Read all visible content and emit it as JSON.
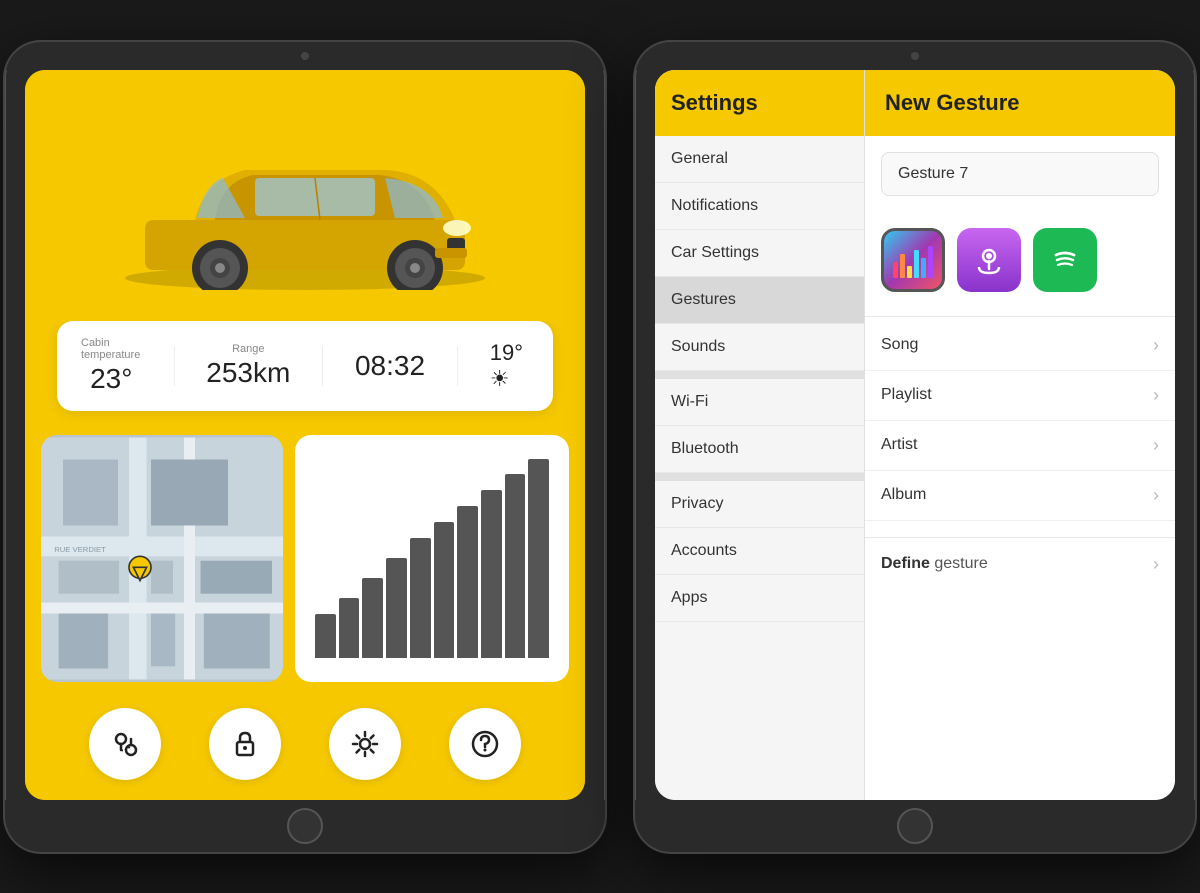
{
  "scene": {
    "background": "#1a1a1a"
  },
  "left_tablet": {
    "info": {
      "cabin_label": "Cabin temperature",
      "cabin_value": "23°",
      "range_label": "Range",
      "range_value": "253km",
      "time_value": "08:32",
      "temp_value": "19°"
    },
    "actions": [
      {
        "icon": "📍",
        "name": "location"
      },
      {
        "icon": "🔒",
        "name": "lock"
      },
      {
        "icon": "⚙️",
        "name": "settings"
      },
      {
        "icon": "❓",
        "name": "help"
      }
    ],
    "chart_bars": [
      3,
      4,
      5,
      6,
      8,
      9,
      10,
      11,
      12,
      13
    ]
  },
  "right_tablet": {
    "settings_header": "Settings",
    "gesture_header": "New Gesture",
    "gesture_name_placeholder": "Gesture 7",
    "menu_items": [
      {
        "label": "General",
        "active": false,
        "section_gap": false
      },
      {
        "label": "Notifications",
        "active": false,
        "section_gap": false
      },
      {
        "label": "Car Settings",
        "active": false,
        "section_gap": false
      },
      {
        "label": "Gestures",
        "active": true,
        "section_gap": false
      },
      {
        "label": "Sounds",
        "active": false,
        "section_gap": false
      },
      {
        "label": "Wi-Fi",
        "active": false,
        "section_gap": true
      },
      {
        "label": "Bluetooth",
        "active": false,
        "section_gap": false
      },
      {
        "label": "Privacy",
        "active": false,
        "section_gap": true
      },
      {
        "label": "Accounts",
        "active": false,
        "section_gap": false
      },
      {
        "label": "Apps",
        "active": false,
        "section_gap": false
      }
    ],
    "gesture_options": [
      {
        "label": "Song"
      },
      {
        "label": "Playlist"
      },
      {
        "label": "Artist"
      },
      {
        "label": "Album"
      }
    ],
    "define_gesture_bold": "Define",
    "define_gesture_light": " gesture"
  }
}
